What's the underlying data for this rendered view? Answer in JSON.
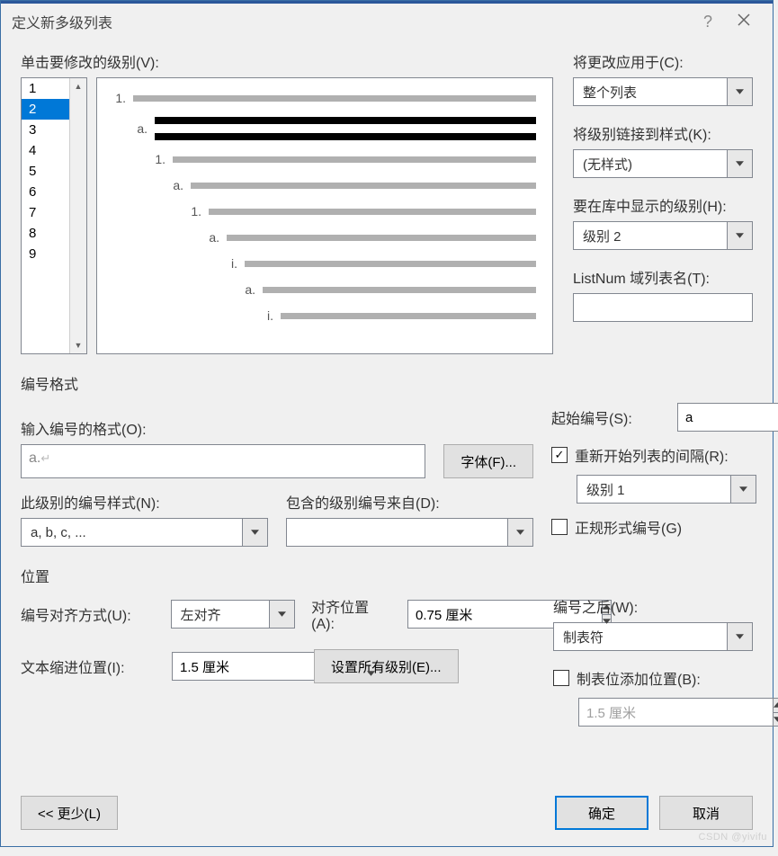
{
  "title": "定义新多级列表",
  "watermark": "CSDN @yivifu",
  "labels": {
    "levelToModify": "单击要修改的级别(V):",
    "applyChangesTo": "将更改应用于(C):",
    "linkLevelToStyle": "将级别链接到样式(K):",
    "levelInGallery": "要在库中显示的级别(H):",
    "listNumFieldName": "ListNum 域列表名(T):",
    "numberFormatSection": "编号格式",
    "enterFormat": "输入编号的格式(O):",
    "fontBtn": "字体(F)...",
    "numberStyle": "此级别的编号样式(N):",
    "includeLevelFrom": "包含的级别编号来自(D):",
    "startAt": "起始编号(S):",
    "restartList": "重新开始列表的间隔(R):",
    "legalStyle": "正规形式编号(G)",
    "positionSection": "位置",
    "numberAlign": "编号对齐方式(U):",
    "alignedAt": "对齐位置(A):",
    "textIndent": "文本缩进位置(I):",
    "setAllLevels": "设置所有级别(E)...",
    "followNumberWith": "编号之后(W):",
    "addTabStop": "制表位添加位置(B):",
    "lessBtn": "<< 更少(L)",
    "okBtn": "确定",
    "cancelBtn": "取消"
  },
  "levels": [
    "1",
    "2",
    "3",
    "4",
    "5",
    "6",
    "7",
    "8",
    "9"
  ],
  "selectedLevel": "2",
  "preview": {
    "markers": [
      "1.",
      "a.",
      "1.",
      "a.",
      "1.",
      "a.",
      "i.",
      "a.",
      "i."
    ],
    "indents": [
      0,
      24,
      44,
      64,
      84,
      104,
      124,
      144,
      164
    ],
    "activeIndex": 1
  },
  "applyTo": "整个列表",
  "linkStyle": "(无样式)",
  "galleryLevel": "级别 2",
  "listNumName": "",
  "formatValue": "a.",
  "numberStyleValue": "a, b, c, ...",
  "includeFromValue": "",
  "startAtValue": "a",
  "restartChecked": true,
  "restartLevel": "级别 1",
  "legalChecked": false,
  "alignValue": "左对齐",
  "alignedAtValue": "0.75 厘米",
  "textIndentValue": "1.5 厘米",
  "followWith": "制表符",
  "tabStopChecked": false,
  "tabStopValue": "1.5 厘米"
}
